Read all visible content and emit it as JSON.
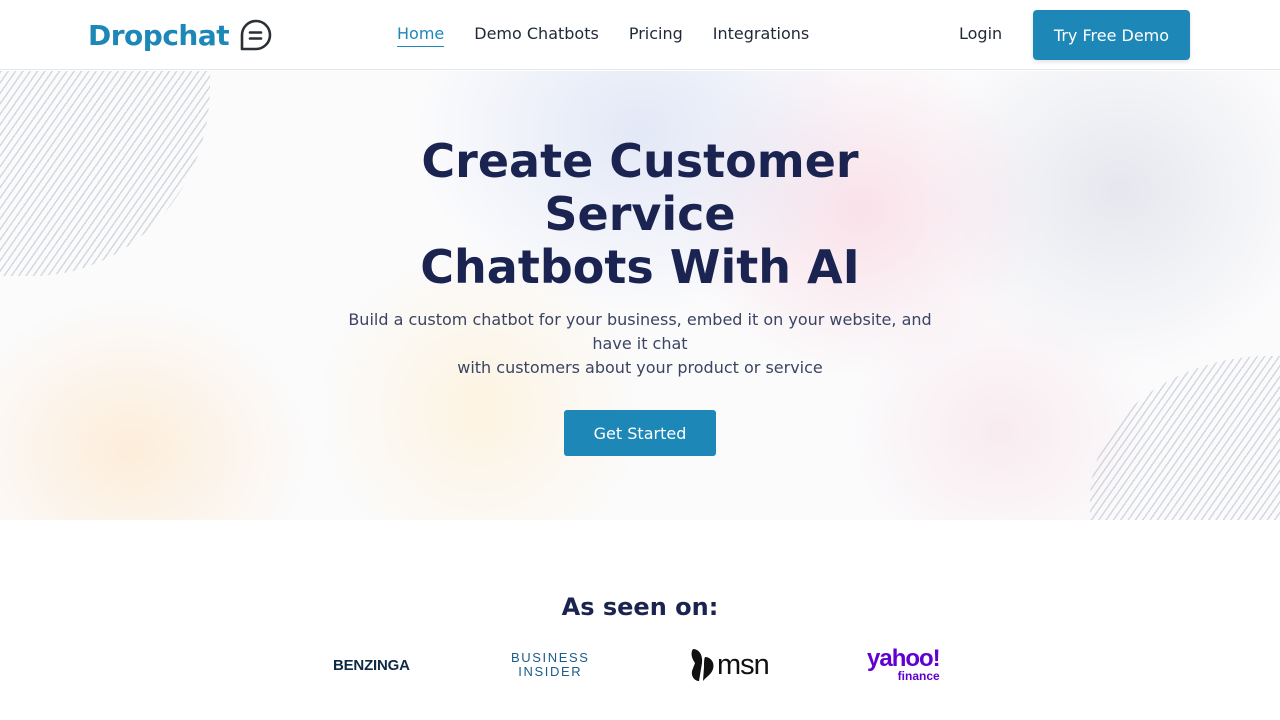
{
  "header": {
    "logo_text": "Dropchat",
    "nav": [
      {
        "label": "Home",
        "active": true
      },
      {
        "label": "Demo Chatbots",
        "active": false
      },
      {
        "label": "Pricing",
        "active": false
      },
      {
        "label": "Integrations",
        "active": false
      }
    ],
    "login_label": "Login",
    "demo_button_label": "Try Free Demo"
  },
  "hero": {
    "title_lines": [
      "Create Customer",
      "Service",
      "Chatbots With AI"
    ],
    "subtitle_lines": [
      "Build a custom chatbot for your business, embed it on your website, and",
      "have it chat",
      "with customers about your product or service"
    ],
    "cta_label": "Get Started"
  },
  "press": {
    "title": "As seen on:",
    "logos": {
      "benzinga": "BENZINGA",
      "business_insider_line1": "BUSINESS",
      "business_insider_line2": "INSIDER",
      "msn": "msn",
      "yahoo_line1": "yahoo!",
      "yahoo_line2": "finance"
    }
  },
  "colors": {
    "brand": "#1d87b8",
    "heading": "#1b2450",
    "text": "#1f2937",
    "yahoo": "#6001d2"
  },
  "icons": {
    "logo": "chat-bubble-icon",
    "msn": "butterfly-icon"
  }
}
